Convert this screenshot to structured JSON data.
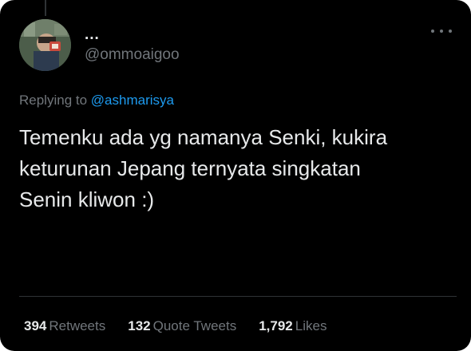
{
  "colors": {
    "background": "#000000",
    "text_primary": "#e7e9ea",
    "text_secondary": "#71767b",
    "accent": "#1d9bf0",
    "divider": "#2f3336"
  },
  "author": {
    "display_name": "...",
    "handle": "@ommoaigoo",
    "avatar_icon": "profile-photo"
  },
  "menu": {
    "more_icon": "more-horizontal-icon"
  },
  "reply": {
    "prefix": "Replying to",
    "mention": "@ashmarisya"
  },
  "tweet": {
    "text": "Temenku ada yg namanya Senki, kukira\nketurunan Jepang ternyata singkatan\nSenin kliwon :)"
  },
  "stats": {
    "retweets": {
      "count": "394",
      "label": "Retweets"
    },
    "quotes": {
      "count": "132",
      "label": "Quote Tweets"
    },
    "likes": {
      "count": "1,792",
      "label": "Likes"
    }
  }
}
